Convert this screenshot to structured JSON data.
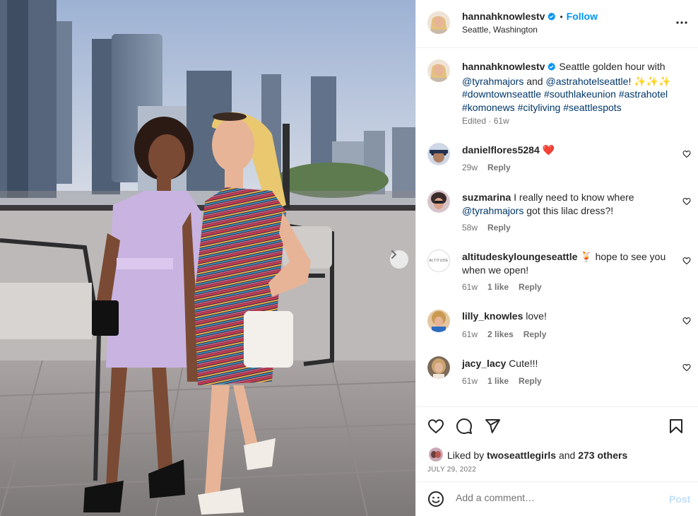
{
  "post": {
    "username": "hannahknowlestv",
    "follow_label": "Follow",
    "location": "Seattle, Washington",
    "caption_text": "Seattle golden hour with",
    "caption_mention_1": "@tyrahmajors",
    "caption_and": "and",
    "caption_mention_2": "@astrahotelseattle",
    "caption_bang": "!",
    "caption_emoji": "✨✨✨",
    "caption_tags": [
      "#downtownseattle",
      "#southlakeunion",
      "#astrahotel",
      "#komonews",
      "#cityliving",
      "#seattlespots"
    ],
    "caption_meta": "Edited · 61w"
  },
  "comments": [
    {
      "username": "danielflores5284",
      "text": "❤️",
      "time": "29w",
      "likes": "",
      "reply": "Reply"
    },
    {
      "username": "suzmarina",
      "text_before": "I really need to know where",
      "mention": "@tyrahmajors",
      "text_after": "got this lilac dress?!",
      "time": "58w",
      "likes": "",
      "reply": "Reply"
    },
    {
      "username": "altitudeskyloungeseattle",
      "text": "🍹 hope to see you when we open!",
      "time": "61w",
      "likes": "1 like",
      "reply": "Reply",
      "avatar_text": "ALTITUDE"
    },
    {
      "username": "lilly_knowles",
      "text": "love!",
      "time": "61w",
      "likes": "2 likes",
      "reply": "Reply"
    },
    {
      "username": "jacy_lacy",
      "text": "Cute!!!",
      "time": "61w",
      "likes": "1 like",
      "reply": "Reply"
    }
  ],
  "likes": {
    "prefix": "Liked by",
    "user": "twoseattlegirls",
    "and": "and",
    "others": "273 others"
  },
  "date": "JULY 29, 2022",
  "comment_box": {
    "placeholder": "Add a comment…",
    "post_label": "Post"
  },
  "colors": {
    "accent": "#0095f6",
    "verified": "#0095f6",
    "link": "#00376b",
    "muted": "#737373",
    "heart_red": "#ed4956"
  },
  "icons": {
    "more": "more-horizontal-icon",
    "like": "heart-icon",
    "comment": "comment-icon",
    "share": "paper-plane-icon",
    "save": "bookmark-icon",
    "emoji": "emoji-icon",
    "next": "chevron-right-icon"
  }
}
